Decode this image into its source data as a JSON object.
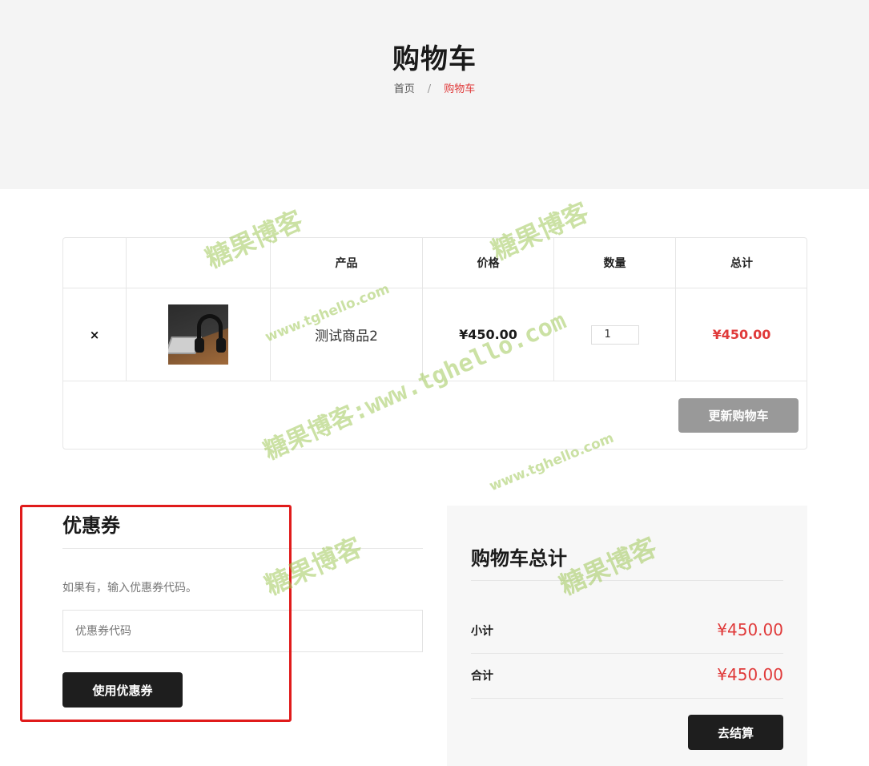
{
  "page": {
    "title": "购物车",
    "breadcrumb": {
      "home": "首页",
      "separator": "/",
      "current": "购物车"
    }
  },
  "cart": {
    "headers": {
      "remove": "",
      "thumbnail": "",
      "product": "产品",
      "price": "价格",
      "quantity": "数量",
      "subtotal": "总计"
    },
    "items": [
      {
        "remove_icon": "×",
        "name": "测试商品2",
        "price": "¥450.00",
        "quantity": "1",
        "subtotal": "¥450.00",
        "image_icon": "product-thumbnail-headphones"
      }
    ],
    "update_label": "更新购物车"
  },
  "coupon": {
    "title": "优惠券",
    "hint": "如果有，输入优惠券代码。",
    "placeholder": "优惠券代码",
    "apply_label": "使用优惠券"
  },
  "totals": {
    "title": "购物车总计",
    "subtotal_label": "小计",
    "subtotal_value": "¥450.00",
    "total_label": "合计",
    "total_value": "¥450.00",
    "checkout_label": "去结算"
  },
  "watermarks": {
    "brand": "糖果博客",
    "url": "www.tghello.com",
    "combined": "糖果博客:www.tghello.com"
  },
  "colors": {
    "accent": "#e03a3a",
    "dark_button": "#1e1e1e",
    "muted_button": "#999999",
    "highlight": "#e01b1b"
  }
}
